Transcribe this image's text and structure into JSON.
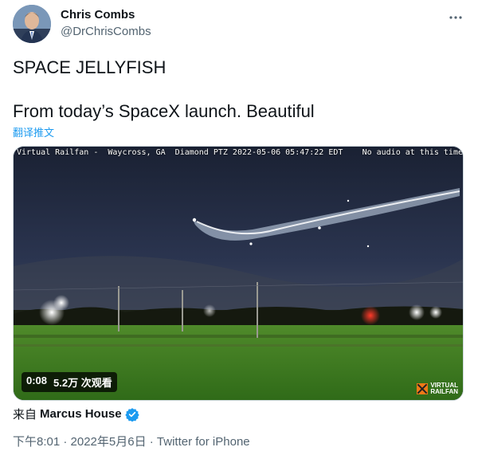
{
  "author": {
    "display_name": "Chris Combs",
    "handle": "@DrChrisCombs"
  },
  "tweet": {
    "text_line1": "SPACE JELLYFISH",
    "text_line2": "From today’s SpaceX launch. Beautiful",
    "translate_label": "翻译推文"
  },
  "media": {
    "overlay_left": "Virtual Railfan -  Waycross, GA  Diamond PTZ 2022-05-06 05:47:22 EDT",
    "overlay_right": "No audio at this time",
    "duration": "0:08",
    "views": "5.2万 次观看",
    "logo_line1": "VIRTUAL",
    "logo_line2": "RAILFAN"
  },
  "via": {
    "prefix": "来自",
    "name": "Marcus House"
  },
  "meta": "下午8:01 · 2022年5月6日 · Twitter for iPhone",
  "icons": {
    "more": "more-horizontal-icon",
    "verified": "verified-badge-icon",
    "logo": "railroad-crossing-icon"
  },
  "colors": {
    "link": "#1d9bf0",
    "secondary_text": "#536471",
    "verified": "#1d9bf0"
  }
}
